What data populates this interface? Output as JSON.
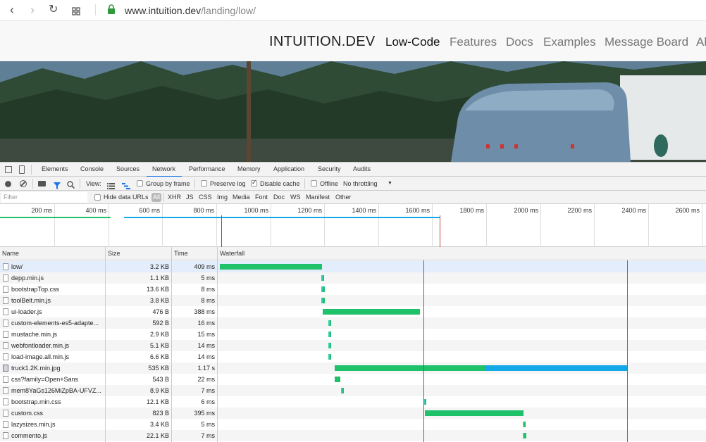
{
  "browser": {
    "url_domain": "www.intuition.dev",
    "url_path": "/landing/low/"
  },
  "site": {
    "brand": "INTUITION.DEV",
    "nav": [
      "Low-Code",
      "Features",
      "Docs",
      "Examples",
      "Message Board",
      "Al"
    ]
  },
  "devtools": {
    "tabs": [
      "Elements",
      "Console",
      "Sources",
      "Network",
      "Performance",
      "Memory",
      "Application",
      "Security",
      "Audits"
    ],
    "active_tab": "Network",
    "toolbar": {
      "view_label": "View:",
      "group_by_frame": "Group by frame",
      "preserve_log": "Preserve log",
      "disable_cache": "Disable cache",
      "offline": "Offline",
      "throttling": "No throttling"
    },
    "filter": {
      "placeholder": "Filter",
      "hide_data_urls": "Hide data URLs",
      "types": [
        "All",
        "XHR",
        "JS",
        "CSS",
        "Img",
        "Media",
        "Font",
        "Doc",
        "WS",
        "Manifest",
        "Other"
      ]
    },
    "overview_ticks": [
      "200 ms",
      "400 ms",
      "600 ms",
      "800 ms",
      "1000 ms",
      "1200 ms",
      "1400 ms",
      "1600 ms",
      "1800 ms",
      "2000 ms",
      "2200 ms",
      "2400 ms",
      "2600 ms"
    ],
    "columns": [
      "Name",
      "Size",
      "Time",
      "Waterfall"
    ],
    "requests": [
      {
        "name": "low/",
        "size": "3.2 KB",
        "time": "409 ms",
        "icon": "document",
        "wait_start": 0.0,
        "start": 0.0,
        "end": 0.409,
        "recv_end": 0.409
      },
      {
        "name": "depp.min.js",
        "size": "1.1 KB",
        "time": "5 ms",
        "icon": "document",
        "wait_start": 0.413,
        "start": 0.413,
        "end": 0.418,
        "recv_end": 0.418
      },
      {
        "name": "bootstrapTop.css",
        "size": "13.6 KB",
        "time": "8 ms",
        "icon": "document",
        "wait_start": 0.413,
        "start": 0.413,
        "end": 0.421,
        "recv_end": 0.421
      },
      {
        "name": "toolBelt.min.js",
        "size": "3.8 KB",
        "time": "8 ms",
        "icon": "document",
        "wait_start": 0.413,
        "start": 0.413,
        "end": 0.421,
        "recv_end": 0.421
      },
      {
        "name": "ui-loader.js",
        "size": "476 B",
        "time": "388 ms",
        "icon": "document",
        "wait_start": 0.413,
        "start": 0.413,
        "end": 0.801,
        "recv_end": 0.801
      },
      {
        "name": "custom-elements-es5-adapte...",
        "size": "592 B",
        "time": "16 ms",
        "icon": "document",
        "wait_start": 0.43,
        "start": 0.44,
        "end": 0.446,
        "recv_end": 0.446
      },
      {
        "name": "mustache.min.js",
        "size": "2.9 KB",
        "time": "15 ms",
        "icon": "document",
        "wait_start": 0.43,
        "start": 0.44,
        "end": 0.445,
        "recv_end": 0.445
      },
      {
        "name": "webfontloader.min.js",
        "size": "5.1 KB",
        "time": "14 ms",
        "icon": "document",
        "wait_start": 0.43,
        "start": 0.44,
        "end": 0.444,
        "recv_end": 0.444
      },
      {
        "name": "load-image.all.min.js",
        "size": "6.6 KB",
        "time": "14 ms",
        "icon": "document",
        "wait_start": 0.43,
        "start": 0.44,
        "end": 0.444,
        "recv_end": 0.444
      },
      {
        "name": "truck1.2K.min.jpg",
        "size": "535 KB",
        "time": "1.17 s",
        "icon": "image",
        "wait_start": 0.46,
        "start": 0.46,
        "end": 1.06,
        "recv_end": 1.63
      },
      {
        "name": "css?family=Open+Sans",
        "size": "543 B",
        "time": "22 ms",
        "icon": "document",
        "wait_start": 0.46,
        "start": 0.46,
        "end": 0.482,
        "recv_end": 0.482
      },
      {
        "name": "mem8YaGs126MiZpBA-UFVZ...",
        "size": "8.9 KB",
        "time": "7 ms",
        "icon": "document",
        "wait_start": 0.49,
        "start": 0.49,
        "end": 0.497,
        "recv_end": 0.497
      },
      {
        "name": "bootstrap.min.css",
        "size": "12.1 KB",
        "time": "6 ms",
        "icon": "document",
        "wait_start": 0.82,
        "start": 0.82,
        "end": 0.826,
        "recv_end": 0.826
      },
      {
        "name": "custom.css",
        "size": "823 B",
        "time": "395 ms",
        "icon": "document",
        "wait_start": 0.82,
        "start": 0.82,
        "end": 1.215,
        "recv_end": 1.215
      },
      {
        "name": "lazysizes.min.js",
        "size": "3.4 KB",
        "time": "5 ms",
        "icon": "document",
        "wait_start": 1.22,
        "start": 1.22,
        "end": 1.225,
        "recv_end": 1.225
      },
      {
        "name": "commento.js",
        "size": "22.1 KB",
        "time": "7 ms",
        "icon": "document",
        "wait_start": 1.22,
        "start": 1.22,
        "end": 1.227,
        "recv_end": 1.227
      }
    ],
    "colors": {
      "waiting": "#1fc16b",
      "receiving": "#12a8e8",
      "dom_content_loaded": "#2d6ad7",
      "load": "#c44a3f",
      "wait_tick": "#40c8b8"
    }
  }
}
